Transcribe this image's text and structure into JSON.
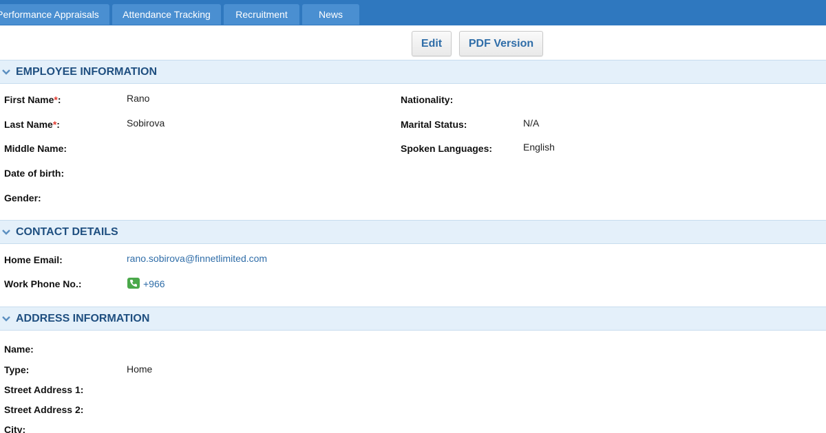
{
  "tabs": [
    {
      "label": "Performance Appraisals"
    },
    {
      "label": "Attendance Tracking"
    },
    {
      "label": "Recruitment"
    },
    {
      "label": "News"
    }
  ],
  "actions": {
    "edit_label": "Edit",
    "pdf_label": "PDF Version"
  },
  "employee_info": {
    "title": "EMPLOYEE INFORMATION",
    "first_name_label": "First Name",
    "first_name": "Rano",
    "last_name_label": "Last Name",
    "last_name": "Sobirova",
    "middle_name_label": "Middle Name:",
    "dob_label": "Date of birth:",
    "gender_label": "Gender:",
    "nationality_label": "Nationality:",
    "marital_status_label": "Marital Status:",
    "marital_status": "N/A",
    "spoken_languages_label": "Spoken Languages:",
    "spoken_languages": "English",
    "required_mark": "*",
    "colon": ":"
  },
  "contact": {
    "title": "CONTACT DETAILS",
    "home_email_label": "Home Email:",
    "home_email": "rano.sobirova@finnetlimited.com",
    "work_phone_label": "Work Phone No.:",
    "work_phone": "+966"
  },
  "address": {
    "title": "ADDRESS INFORMATION",
    "name_label": "Name:",
    "type_label": "Type:",
    "type": "Home",
    "street1_label": "Street Address 1:",
    "street2_label": "Street Address 2:",
    "city_label": "City:"
  },
  "colors": {
    "tabbar": "#2f78bf",
    "section_bg": "#e4f0fa",
    "section_title": "#1f4f80",
    "link": "#2f6da8",
    "required": "#e03a2f"
  }
}
